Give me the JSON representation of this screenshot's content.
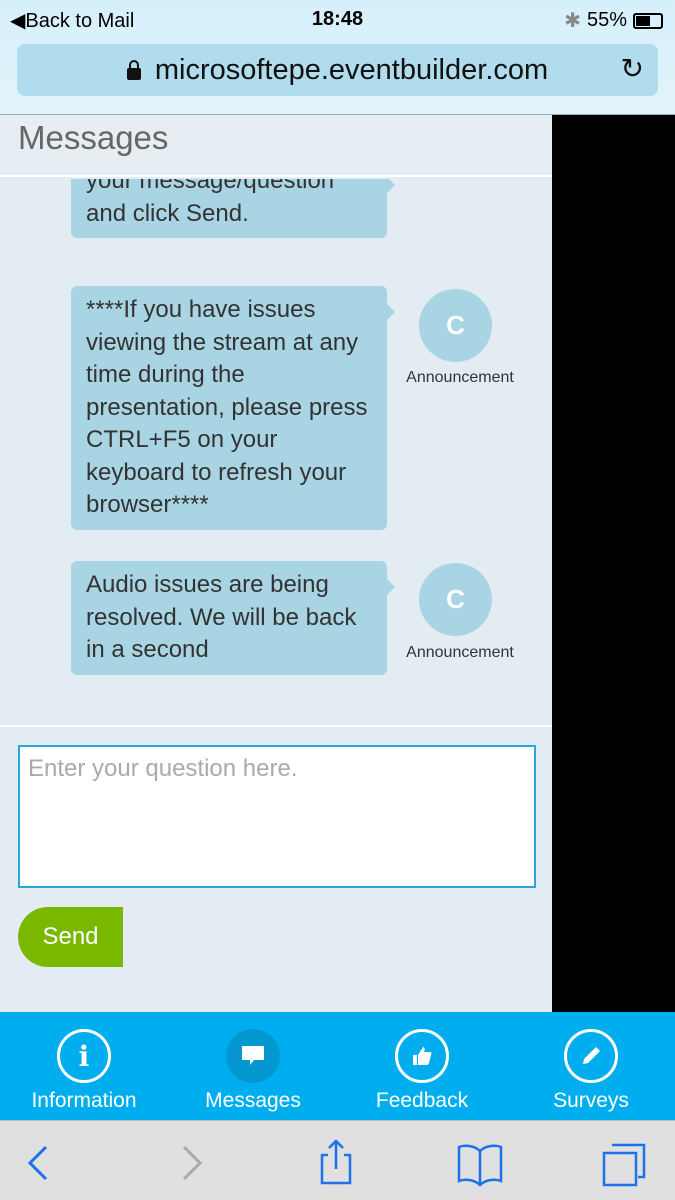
{
  "status": {
    "back": "Back to Mail",
    "time": "18:48",
    "battery": "55%"
  },
  "browser": {
    "url": "microsoftepe.eventbuilder.com"
  },
  "page": {
    "title": "Messages"
  },
  "messages": [
    {
      "text": "your message/question and click Send.",
      "author": ""
    },
    {
      "text": "****If you have issues viewing the stream at any time during the presentation, please press CTRL+F5 on your keyboard to refresh your browser****",
      "author": "Announcement",
      "avatar": "C"
    },
    {
      "text": "Audio issues are being resolved. We will be back in a second",
      "author": "Announcement",
      "avatar": "C"
    }
  ],
  "composer": {
    "placeholder": "Enter your question here.",
    "send": "Send"
  },
  "tabs": [
    {
      "label": "Information"
    },
    {
      "label": "Messages"
    },
    {
      "label": "Feedback"
    },
    {
      "label": "Surveys"
    }
  ]
}
